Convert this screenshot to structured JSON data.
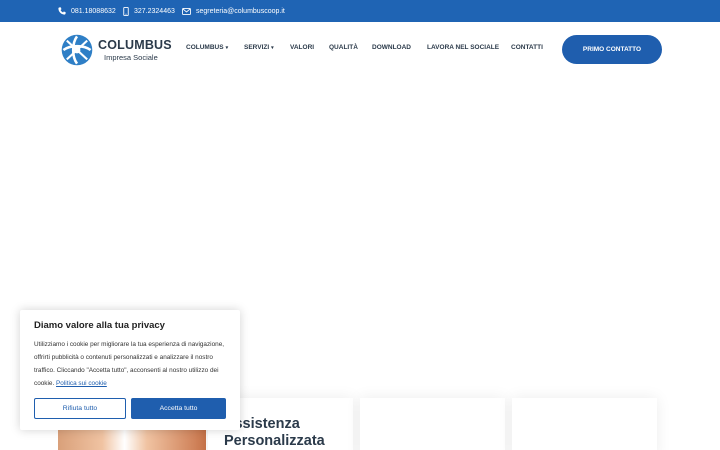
{
  "topbar": {
    "phone": "081.18088632",
    "mobile": "327.2324463",
    "email": "segreteria@columbuscoop.it"
  },
  "logo": {
    "title": "COLUMBUS",
    "subtitle": "Impresa Sociale"
  },
  "nav": {
    "items": [
      {
        "label": "COLUMBUS",
        "dropdown": true
      },
      {
        "label": "SERVIZI",
        "dropdown": true
      },
      {
        "label": "VALORI",
        "dropdown": false
      },
      {
        "label": "QUALITÀ",
        "dropdown": false
      },
      {
        "label": "DOWNLOAD",
        "dropdown": false
      },
      {
        "label": "LAVORA NEL SOCIALE",
        "dropdown": false
      },
      {
        "label": "CONTATTI",
        "dropdown": false
      }
    ],
    "chevron": "▾",
    "cta": "PRIMO CONTATTO"
  },
  "cards": {
    "card1_title": "Assistenza Personalizzata"
  },
  "cookie": {
    "title": "Diamo valore alla tua privacy",
    "body": "Utilizziamo i cookie per migliorare la tua esperienza di navigazione, offrirti pubblicità o contenuti personalizzati e analizzare il nostro traffico. Cliccando \"Accetta tutto\", acconsenti al nostro utilizzo dei cookie.",
    "link": "Politica sui cookie",
    "reject": "Rifiuta tutto",
    "accept": "Accetta tutto"
  },
  "colors": {
    "primary": "#1f5eae",
    "topbar": "#1f64b4",
    "text": "#2b3a4a"
  },
  "icons": [
    "phone-icon",
    "mobile-icon",
    "email-icon",
    "chevron-down-icon"
  ]
}
